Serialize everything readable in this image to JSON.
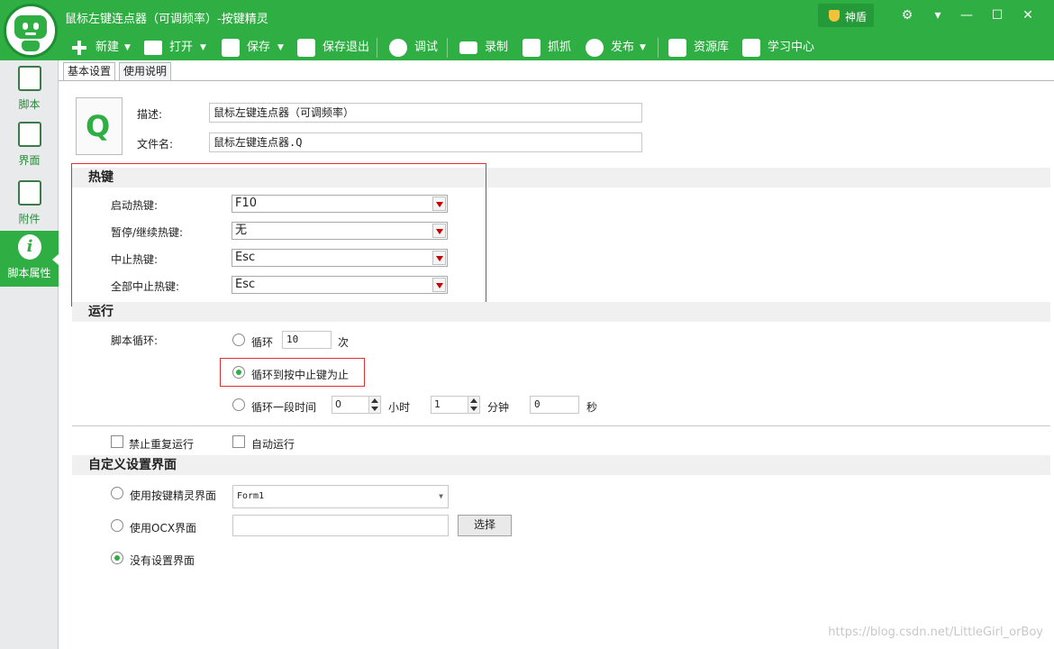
{
  "window": {
    "title": "鼠标左键连点器（可调频率）-按键精灵",
    "shield_label": "神盾",
    "controls": {
      "settings": "⚙",
      "menu": "▾",
      "minimize": "—",
      "maximize": "☐",
      "close": "✕"
    }
  },
  "toolbar": {
    "new": "新建",
    "open": "打开",
    "save": "保存",
    "save_exit": "保存退出",
    "debug": "调试",
    "record": "录制",
    "capture": "抓抓",
    "publish": "发布",
    "resource": "资源库",
    "learn": "学习中心"
  },
  "sidebar": {
    "items": [
      {
        "label": "脚本"
      },
      {
        "label": "界面"
      },
      {
        "label": "附件"
      },
      {
        "label": "脚本属性"
      }
    ]
  },
  "tabs": [
    "基本设置",
    "使用说明"
  ],
  "file": {
    "icon_letter": "Q",
    "desc_label": "描述:",
    "desc_value": "鼠标左键连点器（可调频率）",
    "filename_label": "文件名:",
    "filename_value": "鼠标左键连点器.Q"
  },
  "hotkeys": {
    "section": "热键",
    "start_label": "启动热键:",
    "start_value": "F10",
    "pause_label": "暂停/继续热键:",
    "pause_value": "无",
    "stop_label": "中止热键:",
    "stop_value": "Esc",
    "stopall_label": "全部中止热键:",
    "stopall_value": "Esc"
  },
  "run": {
    "section": "运行",
    "loop_label": "脚本循环:",
    "loop_opt": "循环",
    "loop_count": "10",
    "loop_unit": "次",
    "until_opt": "循环到按中止键为止",
    "period_opt": "循环一段时间",
    "hours_value": "0",
    "hours_unit": "小时",
    "minutes_value": "1",
    "minutes_unit": "分钟",
    "seconds_value": "0",
    "seconds_unit": "秒",
    "selected": "until",
    "no_repeat_label": "禁止重复运行",
    "auto_run_label": "自动运行"
  },
  "custom_ui": {
    "section": "自定义设置界面",
    "use_qm_label": "使用按键精灵界面",
    "use_qm_value": "Form1",
    "use_ocx_label": "使用OCX界面",
    "ocx_value": "",
    "choose_button": "选择",
    "none_label": "没有设置界面",
    "selected": "none"
  },
  "watermark": "https://blog.csdn.net/LittleGirl_orBoy",
  "colors": {
    "accent": "#2fae43",
    "highlight_border": "#e03030"
  }
}
